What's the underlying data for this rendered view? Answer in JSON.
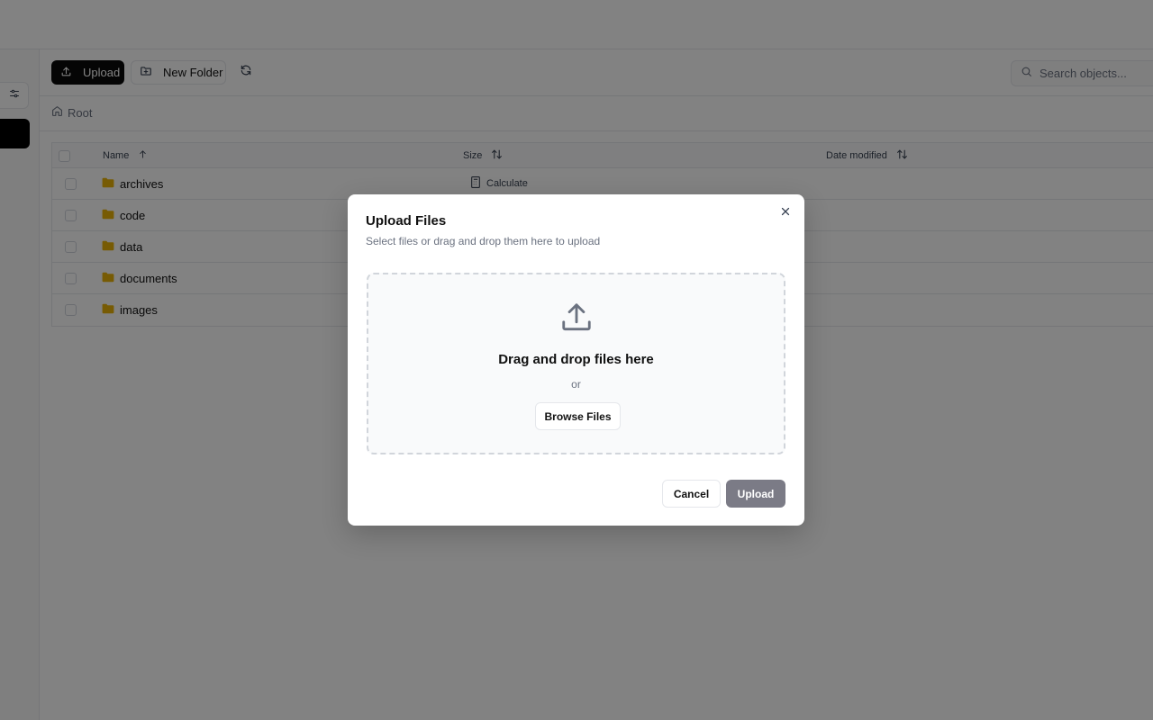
{
  "toolbar": {
    "upload_label": "Upload",
    "new_folder_label": "New Folder",
    "search_placeholder": "Search objects..."
  },
  "breadcrumb": {
    "root_label": "Root"
  },
  "table": {
    "columns": {
      "name": "Name",
      "size": "Size",
      "date_modified": "Date modified"
    },
    "calculate_label": "Calculate",
    "rows": [
      {
        "name": "archives"
      },
      {
        "name": "code"
      },
      {
        "name": "data"
      },
      {
        "name": "documents"
      },
      {
        "name": "images"
      }
    ]
  },
  "modal": {
    "title": "Upload Files",
    "subtitle": "Select files or drag and drop them here to upload",
    "dropzone_title": "Drag and drop files here",
    "dropzone_or": "or",
    "browse_label": "Browse Files",
    "cancel_label": "Cancel",
    "upload_label": "Upload"
  },
  "colors": {
    "overlay": "rgba(0,0,0,0.49)",
    "primary": "#0a0a0a",
    "folder": "#eab308",
    "upload_disabled": "#7b7b86"
  }
}
